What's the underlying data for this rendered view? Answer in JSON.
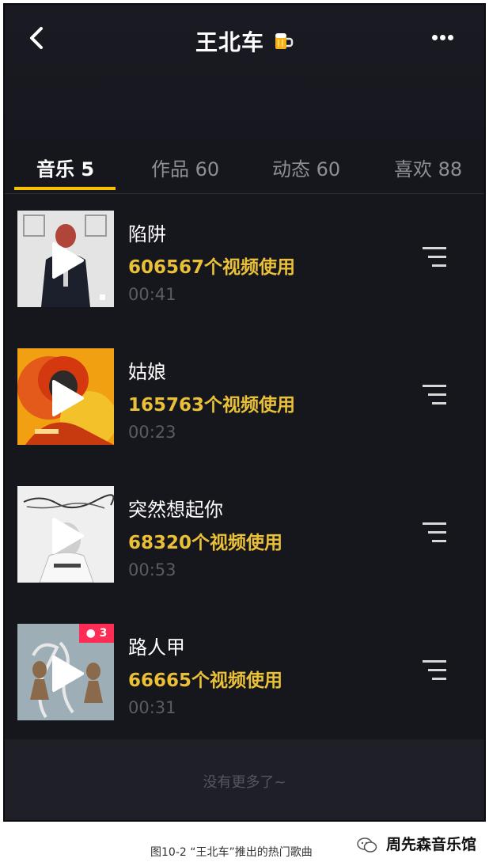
{
  "header": {
    "title": "王北车",
    "back_icon": "chevron-left-icon",
    "title_icon": "beer-mug-icon",
    "more_icon": "more-horizontal-icon"
  },
  "tabs": [
    {
      "label": "音乐 5",
      "active": true
    },
    {
      "label": "作品 60",
      "active": false
    },
    {
      "label": "动态 60",
      "active": false
    },
    {
      "label": "喜欢 88",
      "active": false
    }
  ],
  "songs": [
    {
      "title": "陷阱",
      "usage": "606567个视频使用",
      "duration": "00:41"
    },
    {
      "title": "姑娘",
      "usage": "165763个视频使用",
      "duration": "00:23"
    },
    {
      "title": "突然想起你",
      "usage": "68320个视频使用",
      "duration": "00:53"
    },
    {
      "title": "路人甲",
      "usage": "66665个视频使用",
      "duration": "00:31",
      "badge": "3"
    }
  ],
  "footer": {
    "no_more": "没有更多了~"
  },
  "caption": "图10-2 “王北车”推出的热门歌曲",
  "watermark": "周先森音乐馆",
  "colors": {
    "accent": "#f5c000",
    "usage_text": "#e9c037",
    "background": "#16161d",
    "badge": "#ff2d55"
  }
}
